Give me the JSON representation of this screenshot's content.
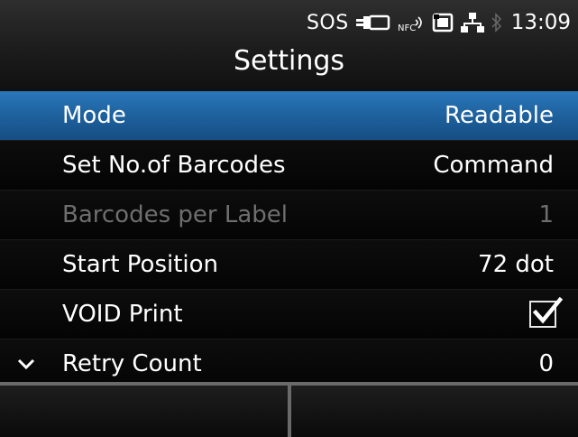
{
  "status_bar": {
    "sos_label": "SOS",
    "battery_icon": "battery-plug-icon",
    "nfc_icon": "nfc-icon",
    "sd_card_icon": "sd-card-icon",
    "network_icon": "network-lan-icon",
    "bluetooth_icon": "bluetooth-icon",
    "clock": "13:09"
  },
  "header": {
    "title": "Settings"
  },
  "settings_list": [
    {
      "label": "Mode",
      "value": "Readable",
      "selected": true,
      "enabled": true
    },
    {
      "label": "Set No.of Barcodes",
      "value": "Command",
      "selected": false,
      "enabled": true
    },
    {
      "label": "Barcodes per Label",
      "value": "1",
      "selected": false,
      "enabled": false
    },
    {
      "label": "Start Position",
      "value": "72 dot",
      "selected": false,
      "enabled": true
    },
    {
      "label": "VOID Print",
      "checked": true,
      "selected": false,
      "enabled": true
    },
    {
      "label": "Retry Count",
      "value": "0",
      "selected": false,
      "enabled": true,
      "more_below_indicator": "chevron-down-icon"
    }
  ],
  "softkeys": {
    "left_label": "",
    "right_label": ""
  },
  "colors": {
    "selection": "#1f65a3",
    "background": "#000000",
    "disabled_text": "#6e6e6e"
  }
}
